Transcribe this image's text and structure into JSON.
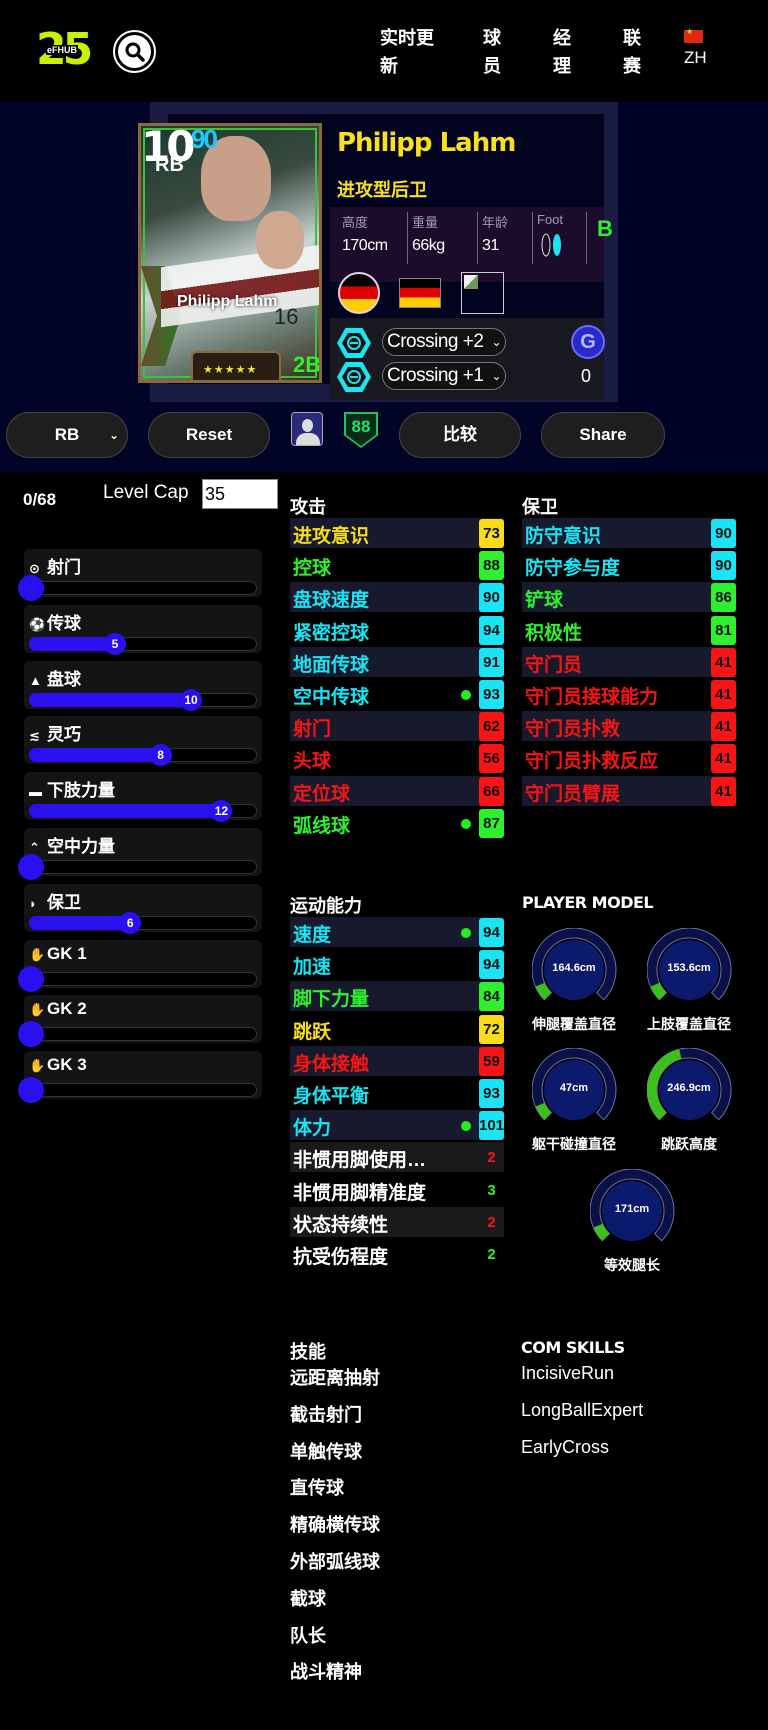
{
  "header": {
    "logo_number": "25",
    "logo_tag": "eFHUB",
    "nav": [
      {
        "line1": "实时更",
        "line2": "新"
      },
      {
        "line1": "球",
        "line2": "员"
      },
      {
        "line1": "经",
        "line2": "理"
      },
      {
        "line1": "联",
        "line2": "赛"
      }
    ],
    "language": "ZH"
  },
  "card": {
    "rating_main": "10",
    "rating_sub": "90",
    "position": "RB",
    "name": "Philipp Lahm",
    "shirt_number": "16",
    "stars": "★★★★★",
    "badge": "2B"
  },
  "player": {
    "name": "Philipp Lahm",
    "playstyle": "进攻型后卫",
    "height_label": "高度",
    "height": "170cm",
    "weight_label": "重量",
    "weight": "66kg",
    "age_label": "年龄",
    "age": "31",
    "foot_label": "Foot",
    "foot_rating": "B",
    "boosters": [
      "Crossing +2",
      "Crossing +1"
    ],
    "g_badge": "G",
    "g_count": "0"
  },
  "actions": {
    "position_select": "RB",
    "reset": "Reset",
    "overall_badge": "88",
    "compare": "比较",
    "share": "Share"
  },
  "level": {
    "points": "0/68",
    "cap_label": "Level Cap",
    "cap_value": "35"
  },
  "progression": {
    "max": 15,
    "items": [
      {
        "icon": "target-icon",
        "glyph": "⊙",
        "label": "射门",
        "value": 0
      },
      {
        "icon": "ball-icon",
        "glyph": "⚽",
        "label": "传球",
        "value": 5
      },
      {
        "icon": "cone-icon",
        "glyph": "▲",
        "label": "盘球",
        "value": 10
      },
      {
        "icon": "agility-icon",
        "glyph": "≲",
        "label": "灵巧",
        "value": 8
      },
      {
        "icon": "boot-icon",
        "glyph": "▬",
        "label": "下肢力量",
        "value": 12
      },
      {
        "icon": "double-chevron-up-icon",
        "glyph": "⌃",
        "label": "空中力量",
        "value": 0
      },
      {
        "icon": "shield-icon",
        "glyph": "◗",
        "label": "保卫",
        "value": 6
      },
      {
        "icon": "glove-icon",
        "glyph": "✋",
        "label": "GK 1",
        "value": 0
      },
      {
        "icon": "glove-icon",
        "glyph": "✋",
        "label": "GK 2",
        "value": 0
      },
      {
        "icon": "glove-icon",
        "glyph": "✋",
        "label": "GK 3",
        "value": 0
      }
    ]
  },
  "colors": {
    "cyan": "#18e4f4",
    "green": "#2ef02e",
    "yellow": "#f8dc18",
    "red": "#f81414",
    "accent_blue": "#2a10f0"
  },
  "attack": {
    "title": "攻击",
    "stats": [
      {
        "name": "进攻意识",
        "value": "73",
        "tier": "yellow",
        "dot": false
      },
      {
        "name": "控球",
        "value": "88",
        "tier": "green",
        "dot": false
      },
      {
        "name": "盘球速度",
        "value": "90",
        "tier": "cyan",
        "dot": false
      },
      {
        "name": "紧密控球",
        "value": "94",
        "tier": "cyan",
        "dot": false
      },
      {
        "name": "地面传球",
        "value": "91",
        "tier": "cyan",
        "dot": false
      },
      {
        "name": "空中传球",
        "value": "93",
        "tier": "cyan",
        "dot": true
      },
      {
        "name": "射门",
        "value": "62",
        "tier": "red",
        "dot": false
      },
      {
        "name": "头球",
        "value": "56",
        "tier": "red",
        "dot": false
      },
      {
        "name": "定位球",
        "value": "66",
        "tier": "red",
        "dot": false
      },
      {
        "name": "弧线球",
        "value": "87",
        "tier": "green",
        "dot": true
      }
    ]
  },
  "defense": {
    "title": "保卫",
    "stats": [
      {
        "name": "防守意识",
        "value": "90",
        "tier": "cyan",
        "dot": false
      },
      {
        "name": "防守参与度",
        "value": "90",
        "tier": "cyan",
        "dot": false
      },
      {
        "name": "铲球",
        "value": "86",
        "tier": "green",
        "dot": false
      },
      {
        "name": "积极性",
        "value": "81",
        "tier": "green",
        "dot": false
      },
      {
        "name": "守门员",
        "value": "41",
        "tier": "red",
        "dot": false
      },
      {
        "name": "守门员接球能力",
        "value": "41",
        "tier": "red",
        "dot": false
      },
      {
        "name": "守门员扑救",
        "value": "41",
        "tier": "red",
        "dot": false
      },
      {
        "name": "守门员扑救反应",
        "value": "41",
        "tier": "red",
        "dot": false
      },
      {
        "name": "守门员臂展",
        "value": "41",
        "tier": "red",
        "dot": false
      }
    ]
  },
  "athleticism": {
    "title": "运动能力",
    "stats": [
      {
        "name": "速度",
        "value": "94",
        "tier": "cyan",
        "dot": true
      },
      {
        "name": "加速",
        "value": "94",
        "tier": "cyan",
        "dot": false
      },
      {
        "name": "脚下力量",
        "value": "84",
        "tier": "green",
        "dot": false
      },
      {
        "name": "跳跃",
        "value": "72",
        "tier": "yellow",
        "dot": false
      },
      {
        "name": "身体接触",
        "value": "59",
        "tier": "red",
        "dot": false
      },
      {
        "name": "身体平衡",
        "value": "93",
        "tier": "cyan",
        "dot": false
      },
      {
        "name": "体力",
        "value": "101",
        "tier": "cyan",
        "dot": true
      },
      {
        "name": "非惯用脚使用…",
        "value": "2",
        "tier": "plain-red",
        "dot": false
      },
      {
        "name": "非惯用脚精准度",
        "value": "3",
        "tier": "plain-green",
        "dot": false
      },
      {
        "name": "状态持续性",
        "value": "2",
        "tier": "plain-red",
        "dot": false
      },
      {
        "name": "抗受伤程度",
        "value": "2",
        "tier": "plain-green",
        "dot": false
      }
    ]
  },
  "player_model": {
    "title": "PLAYER MODEL",
    "gauges": [
      {
        "label": "伸腿覆盖直径",
        "value": "164.6cm",
        "fill": 0.08
      },
      {
        "label": "上肢覆盖直径",
        "value": "153.6cm",
        "fill": 0.08
      },
      {
        "label": "躯干碰撞直径",
        "value": "47cm",
        "fill": 0.08
      },
      {
        "label": "跳跃高度",
        "value": "246.9cm",
        "fill": 0.45
      },
      {
        "label": "等效腿长",
        "value": "171cm",
        "fill": 0.08
      }
    ]
  },
  "skills": {
    "title": "技能",
    "items": [
      "远距离抽射",
      "截击射门",
      "单触传球",
      "直传球",
      "精确横传球",
      "外部弧线球",
      "截球",
      "队长",
      "战斗精神"
    ]
  },
  "com_skills": {
    "title": "COM SKILLS",
    "items": [
      "IncisiveRun",
      "LongBallExpert",
      "EarlyCross"
    ]
  }
}
